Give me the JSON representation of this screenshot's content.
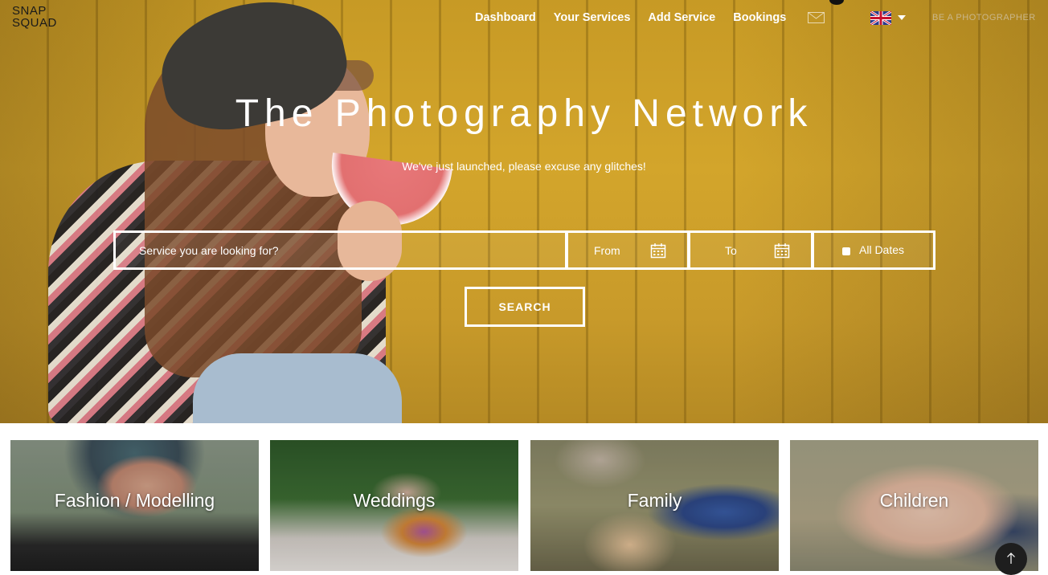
{
  "header": {
    "logo_line1": "SNAP",
    "logo_line2": "SQUAD",
    "nav": [
      {
        "label": "Dashboard"
      },
      {
        "label": "Your Services"
      },
      {
        "label": "Add Service"
      },
      {
        "label": "Bookings"
      }
    ],
    "mail_icon": "mail-icon",
    "language_flag": "uk-flag-icon",
    "be_photographer_label": "BE A PHOTOGRAPHER"
  },
  "hero": {
    "title": "The Photography Network",
    "subtitle": "We've just launched, please excuse any glitches!"
  },
  "search": {
    "service_placeholder": "Service you are looking for?",
    "from_label": "From",
    "to_label": "To",
    "all_dates_label": "All Dates",
    "button_label": "SEARCH"
  },
  "categories": [
    {
      "label": "Fashion / Modelling"
    },
    {
      "label": "Weddings"
    },
    {
      "label": "Family"
    },
    {
      "label": "Children"
    }
  ],
  "colors": {
    "accent_text": "#ffffff",
    "hero_background": "#d3a52b",
    "be_photographer": "#c9b68a"
  }
}
